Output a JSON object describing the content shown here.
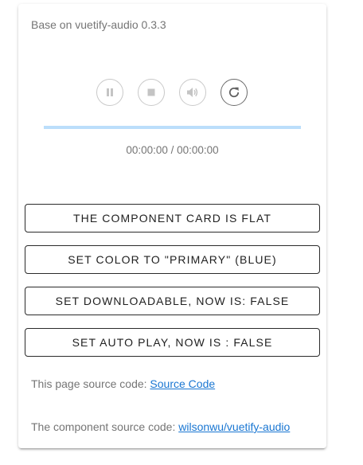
{
  "card": {
    "title": "Base on vuetify-audio 0.3.3"
  },
  "player": {
    "controls": [
      {
        "icon": "pause-icon",
        "state": "disabled"
      },
      {
        "icon": "stop-icon",
        "state": "disabled"
      },
      {
        "icon": "volume-icon",
        "state": "disabled"
      },
      {
        "icon": "refresh-icon",
        "state": "enabled"
      }
    ],
    "progress": 0,
    "time": "00:00:00 / 00:00:00",
    "colors": {
      "progress_track": "#bbdefb",
      "progress_fill": "#2196f3"
    }
  },
  "buttons": {
    "flat": "The component card is flat",
    "color": "Set color to \"primary\" (blue)",
    "downloadable": "Set downloadable, now is: false",
    "autoplay": "Set auto play, now is : false"
  },
  "footer": {
    "page_source_label": "This page source code: ",
    "page_source_link": "Source Code",
    "component_source_label": "The component source code: ",
    "component_source_link": "wilsonwu/vuetify-audio"
  },
  "colors": {
    "link": "#1976d2",
    "text_secondary": "#757575"
  }
}
